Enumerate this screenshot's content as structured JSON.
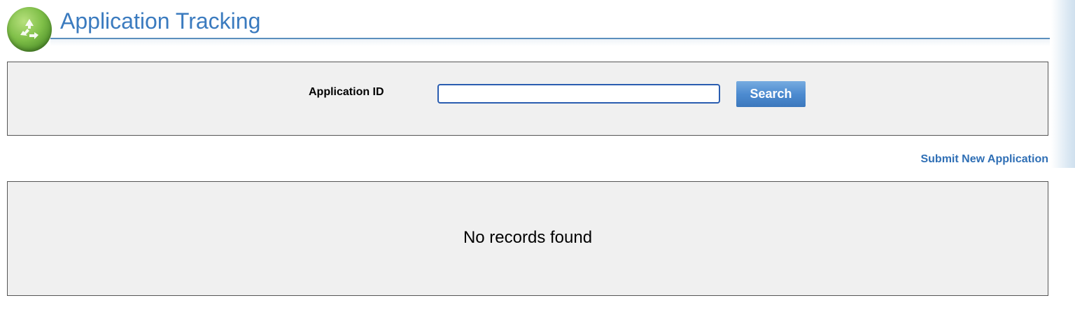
{
  "header": {
    "title": "Application Tracking",
    "logo_icon": "recycle-icon",
    "title_color": "#3b7bbf",
    "logo_color": "#7fbf48"
  },
  "search": {
    "label": "Application ID",
    "input_value": "",
    "button_label": "Search",
    "button_color": "#4d8bd0"
  },
  "actions": {
    "submit_new_label": "Submit New Application"
  },
  "results": {
    "empty_message": "No records found"
  }
}
